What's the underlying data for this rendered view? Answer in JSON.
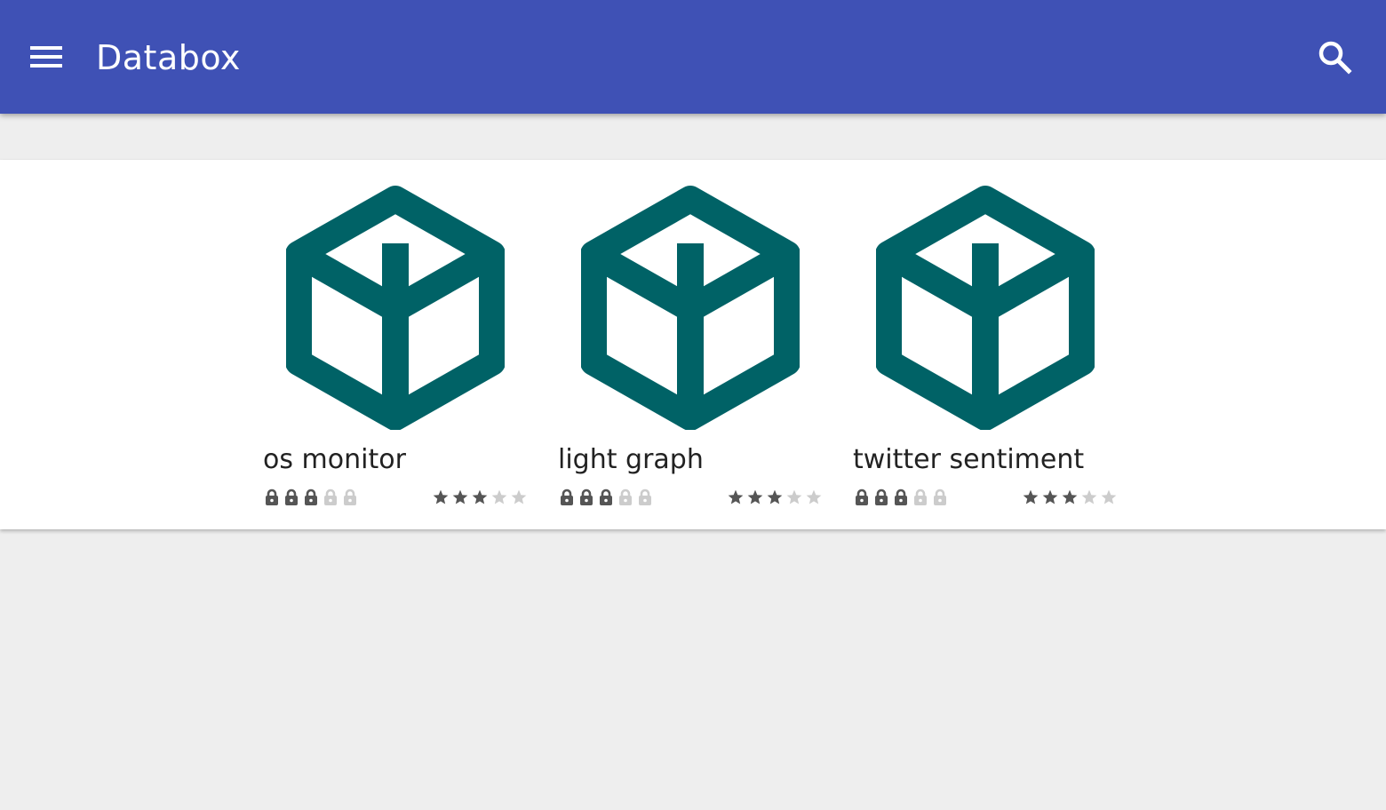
{
  "app_bar": {
    "title": "Databox",
    "menu_icon": "menu-icon",
    "search_icon": "search-icon",
    "background": "#3f51b5"
  },
  "apps": [
    {
      "name": "os monitor",
      "icon": "cube-icon",
      "lock_level": 3,
      "lock_max": 5,
      "rating": 3,
      "rating_max": 5
    },
    {
      "name": "light graph",
      "icon": "cube-icon",
      "lock_level": 3,
      "lock_max": 5,
      "rating": 3,
      "rating_max": 5
    },
    {
      "name": "twitter sentiment",
      "icon": "cube-icon",
      "lock_level": 3,
      "lock_max": 5,
      "rating": 3,
      "rating_max": 5
    }
  ],
  "colors": {
    "icon": "#006266",
    "active_mark": "#555555",
    "inactive_mark": "#cccccc"
  }
}
